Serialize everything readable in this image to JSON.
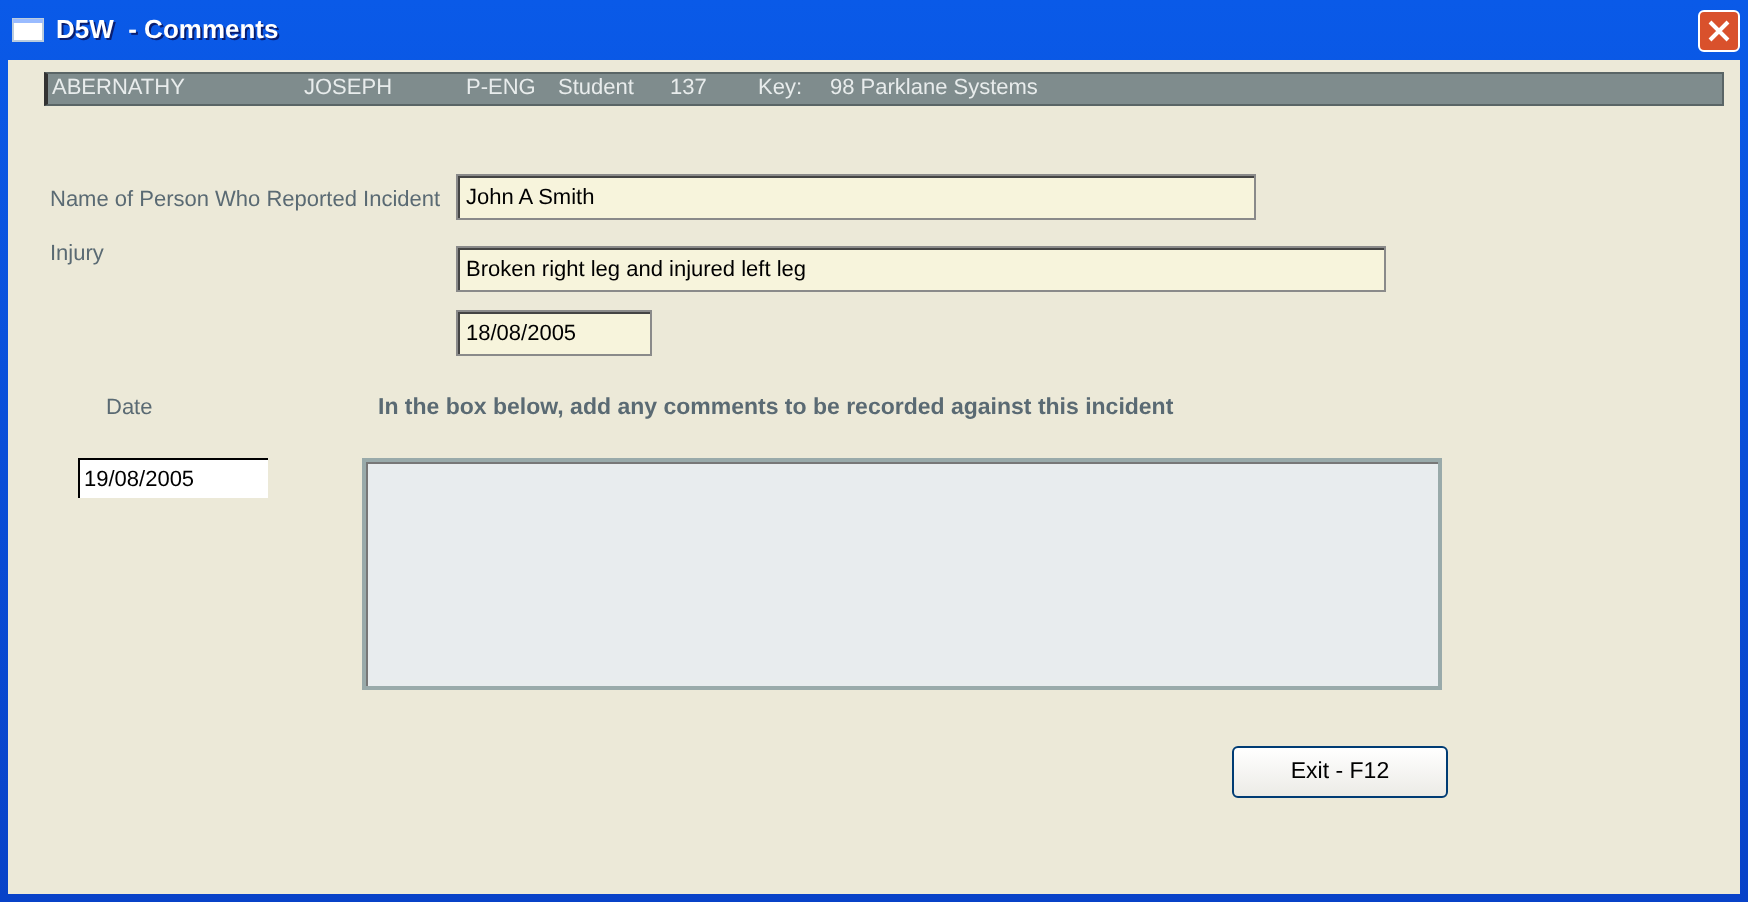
{
  "window": {
    "title": "D5W  - Comments"
  },
  "header": [
    "ABERNATHY",
    "JOSEPH",
    "P-ENG",
    "Student",
    "137",
    "Key:",
    "98 Parklane Systems"
  ],
  "reporter": {
    "label": "Name of Person Who Reported Incident",
    "value": "John A Smith"
  },
  "injury": {
    "label": "Injury",
    "value": "Broken right leg and injured left leg",
    "date": "18/08/2005"
  },
  "comment": {
    "date_label": "Date",
    "instruction": "In the box below, add any comments to be recorded against this incident",
    "date": "19/08/2005"
  },
  "buttons": [
    "Exit - F12"
  ]
}
